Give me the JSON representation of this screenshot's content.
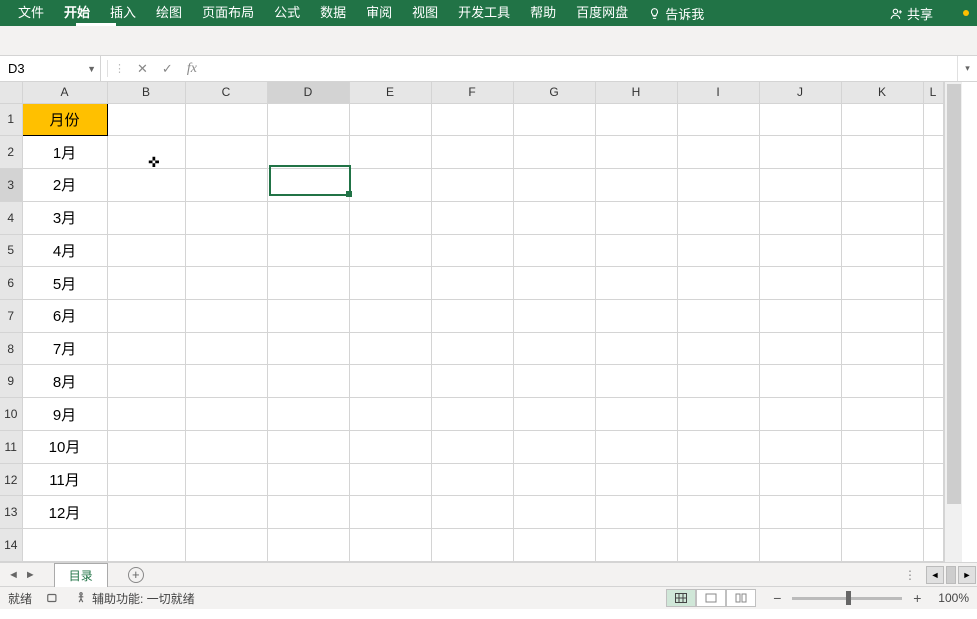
{
  "ribbon": {
    "items": [
      "文件",
      "开始",
      "插入",
      "绘图",
      "页面布局",
      "公式",
      "数据",
      "审阅",
      "视图",
      "开发工具",
      "帮助",
      "百度网盘"
    ],
    "tell_me": "告诉我",
    "share": "共享",
    "active_index": 1
  },
  "formula_bar": {
    "name_box": "D3",
    "cancel": "✕",
    "enter": "✓",
    "fx": "fx",
    "formula": ""
  },
  "grid": {
    "columns": [
      "A",
      "B",
      "C",
      "D",
      "E",
      "F",
      "G",
      "H",
      "I",
      "J",
      "K",
      "L"
    ],
    "row_count": 14,
    "active_cell": "D3",
    "header_cell": {
      "r": 1,
      "c": "A",
      "value": "月份"
    },
    "data": [
      "1月",
      "2月",
      "3月",
      "4月",
      "5月",
      "6月",
      "7月",
      "8月",
      "9月",
      "10月",
      "11月",
      "12月"
    ]
  },
  "tabs": {
    "active": "目录"
  },
  "statusbar": {
    "ready": "就绪",
    "accessibility": "辅助功能: 一切就绪",
    "zoom": "100%"
  }
}
